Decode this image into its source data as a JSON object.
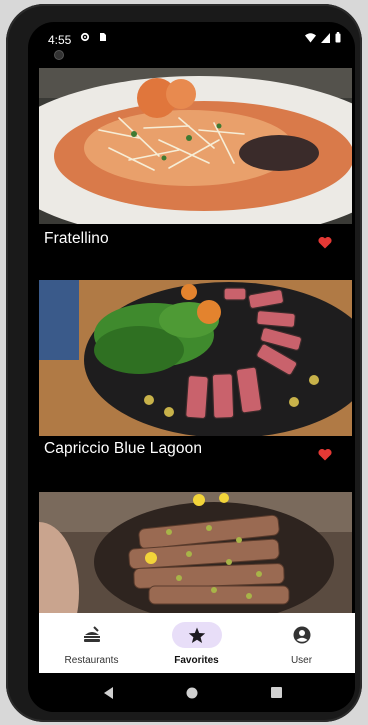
{
  "status_bar": {
    "time": "4:55"
  },
  "restaurants": [
    {
      "name": "Fratellino",
      "favorite": true,
      "image": "pasta-dish-photo"
    },
    {
      "name": "Capriccio Blue Lagoon",
      "favorite": true,
      "image": "seared-tuna-salad-photo"
    },
    {
      "name": "",
      "favorite": true,
      "image": "sliced-steak-pistachio-photo"
    }
  ],
  "bottom_nav": {
    "items": [
      {
        "label": "Restaurants",
        "icon": "restaurant-icon",
        "active": false
      },
      {
        "label": "Favorites",
        "icon": "star-icon",
        "active": true
      },
      {
        "label": "User",
        "icon": "account-circle-icon",
        "active": false
      }
    ]
  },
  "colors": {
    "heart": "#e53935",
    "active_pill": "#e8def8",
    "nav_bg": "#ffffff"
  }
}
